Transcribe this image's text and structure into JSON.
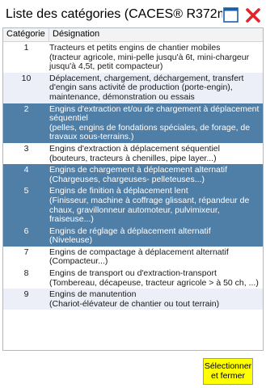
{
  "window": {
    "title": "Liste des catégories (CACES® R372m)"
  },
  "table": {
    "columns": [
      "Catégorie",
      "Désignation"
    ],
    "rows": [
      {
        "cat": "1",
        "des": "Tracteurs et petits engins de chantier mobiles\n(tracteur agricole, mini-pelle jusqu'à 6t, mini-chargeur jusqu'à 4,5t, petit compacteur)",
        "style": "white"
      },
      {
        "cat": "10",
        "des": "Déplacement, chargement, déchargement, transfert d'engin sans activité de production (porte-engin), maintenance, démonstration ou essais",
        "style": "alt"
      },
      {
        "cat": "2",
        "des": "Engins d'extraction et/ou de chargement à déplacement séquentiel\n(pelles, engins de fondations spéciales, de forage, de travaux sous-terrains.)",
        "style": "selected"
      },
      {
        "cat": "3",
        "des": "Engins d'extraction à déplacement séquentiel\n(bouteurs, tracteurs à chenilles, pipe layer...)",
        "style": "white"
      },
      {
        "cat": "4",
        "des": "Engins de chargement à déplacement alternatif\n(Chargeuses, chargeuses- pelleteuses...)",
        "style": "selected"
      },
      {
        "cat": "5",
        "des": "Engins de finition à déplacement lent\n(Finisseur, machine à coffrage glissant, répandeur de chaux, gravillonneur automoteur, pulvimixeur, fraiseuse...)",
        "style": "selected"
      },
      {
        "cat": "6",
        "des": "Engins de réglage à déplacement alternatif\n(Niveleuse)",
        "style": "selected"
      },
      {
        "cat": "7",
        "des": "Engins de compactage à déplacement alternatif\n(Compacteur...)",
        "style": "white"
      },
      {
        "cat": "8",
        "des": "Engins de transport ou d'extraction-transport\n(Tombereau, décapeuse, tracteur agricole > à 50 ch, ...)",
        "style": "white"
      },
      {
        "cat": "9",
        "des": "Engins de manutention\n(Chariot-élévateur de chantier ou tout terrain)",
        "style": "alt"
      }
    ]
  },
  "actions": {
    "select_close_label": "Sélectionner et fermer"
  },
  "icons": {
    "maximize": "maximize-icon",
    "close": "close-icon"
  },
  "colors": {
    "selected_row": "#4f7ea7",
    "alt_row": "#eceef8",
    "close_x": "#e0242a",
    "maximize": "#1c5ea8",
    "button": "#ffff00"
  }
}
